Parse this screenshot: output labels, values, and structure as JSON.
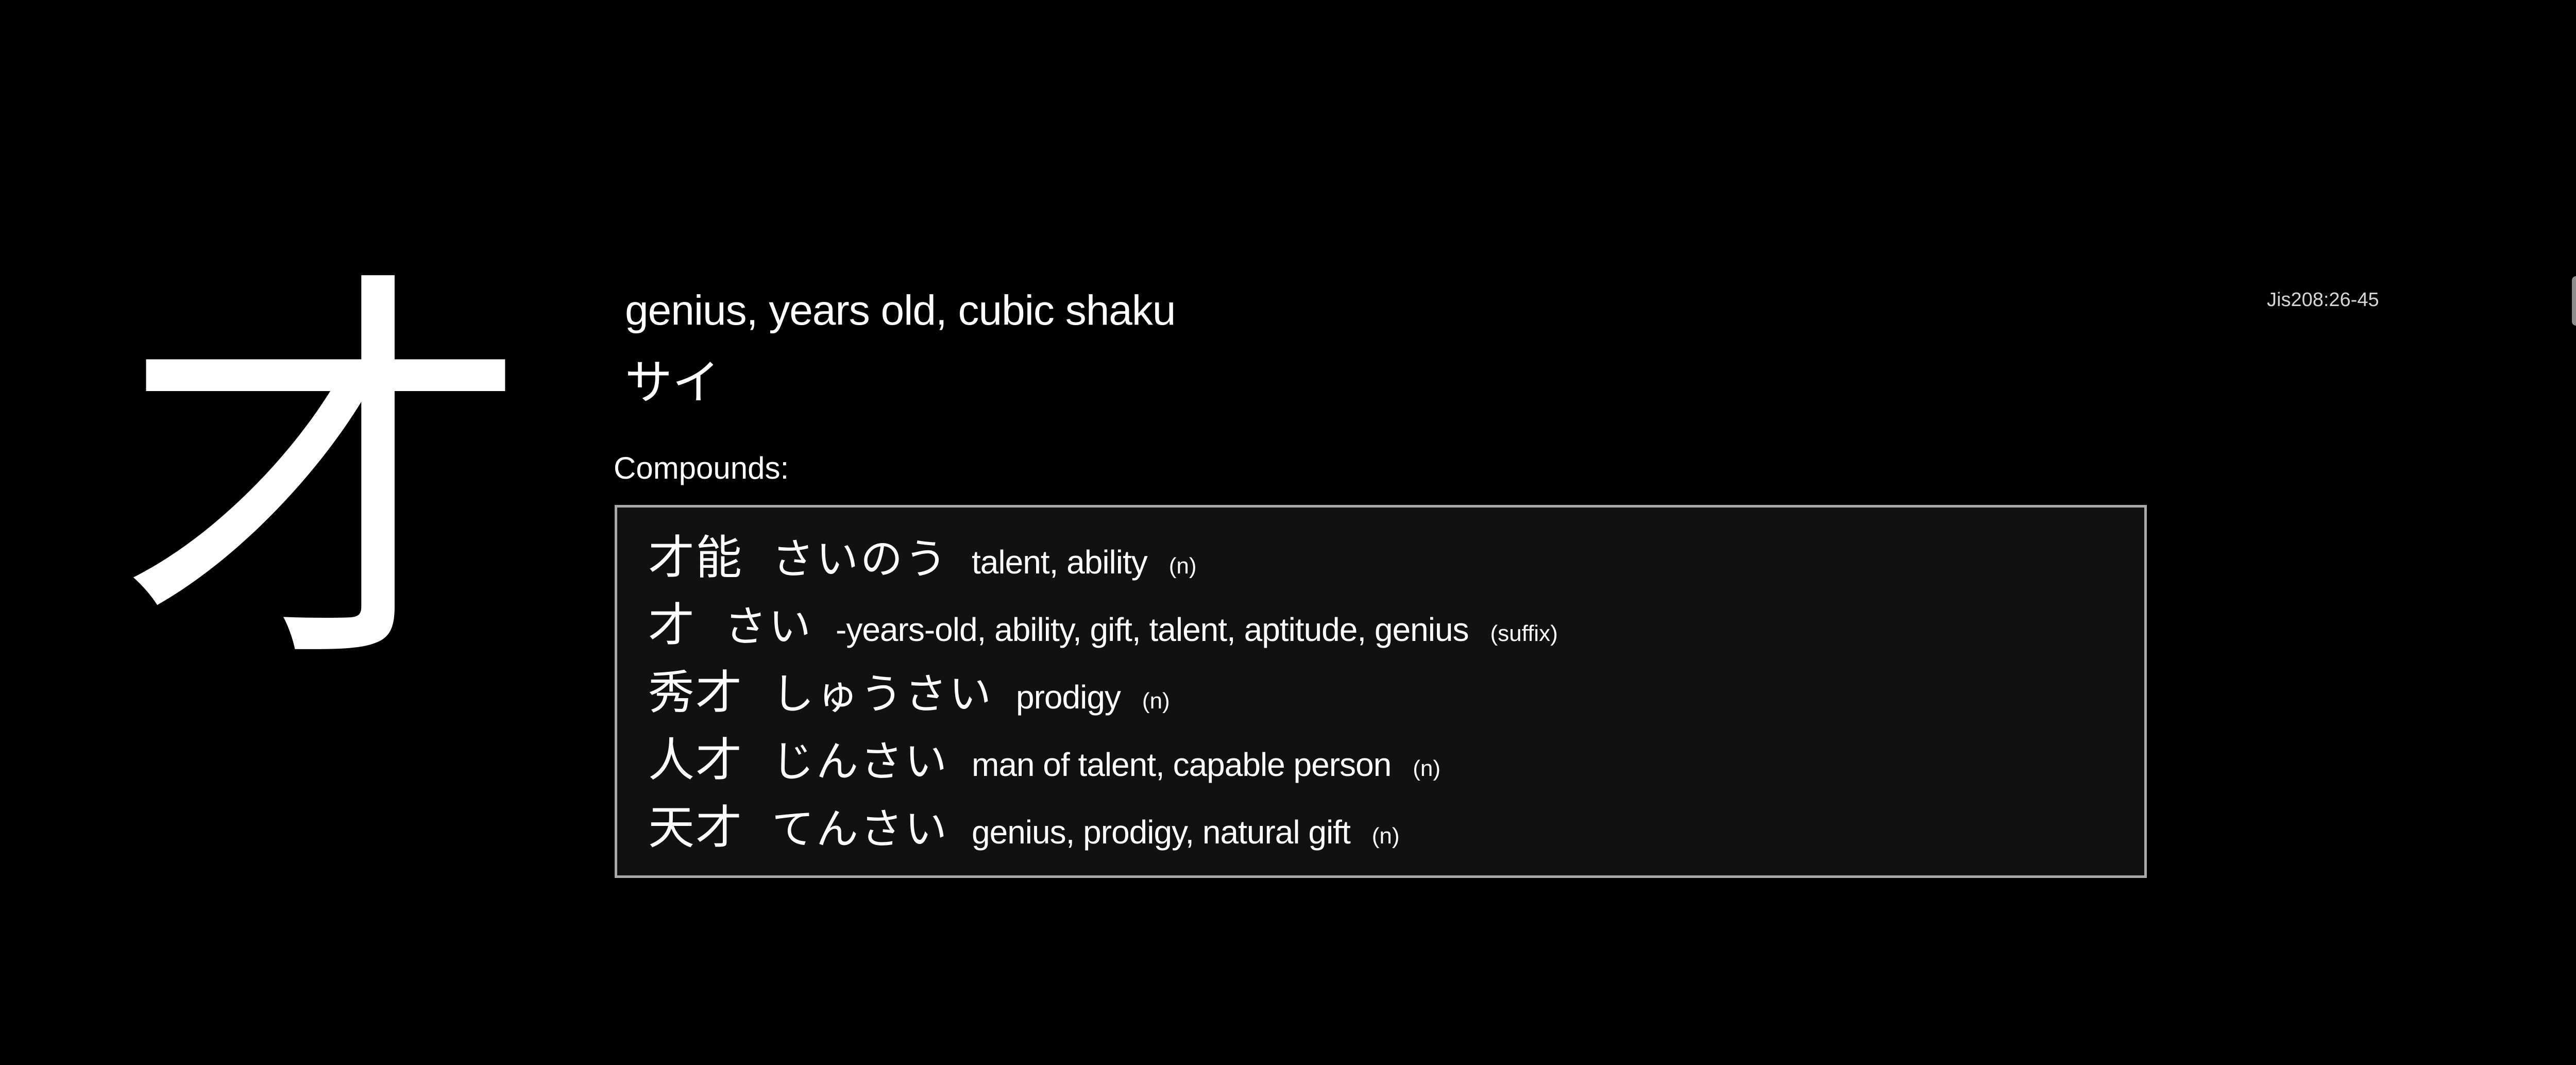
{
  "kanji": {
    "character": "才",
    "meaning": "genius, years old, cubic shaku",
    "reading": "サイ",
    "code": "Jis208:26-45"
  },
  "compounds": {
    "label": "Compounds:",
    "items": [
      {
        "kanji": "才能",
        "kana": "さいのう",
        "gloss": "talent, ability",
        "pos": "(n)"
      },
      {
        "kanji": "才",
        "kana": "さい",
        "gloss": "-years-old, ability, gift, talent, aptitude, genius",
        "pos": "(suffix)"
      },
      {
        "kanji": "秀才",
        "kana": "しゅうさい",
        "gloss": "prodigy",
        "pos": "(n)"
      },
      {
        "kanji": "人才",
        "kana": "じんさい",
        "gloss": "man of talent, capable person",
        "pos": "(n)"
      },
      {
        "kanji": "天才",
        "kana": "てんさい",
        "gloss": "genius, prodigy, natural gift",
        "pos": "(n)"
      }
    ]
  },
  "colors": {
    "background": "#000000",
    "text": "#ffffff",
    "box_background": "#111111",
    "box_border": "#a9a9a9"
  }
}
